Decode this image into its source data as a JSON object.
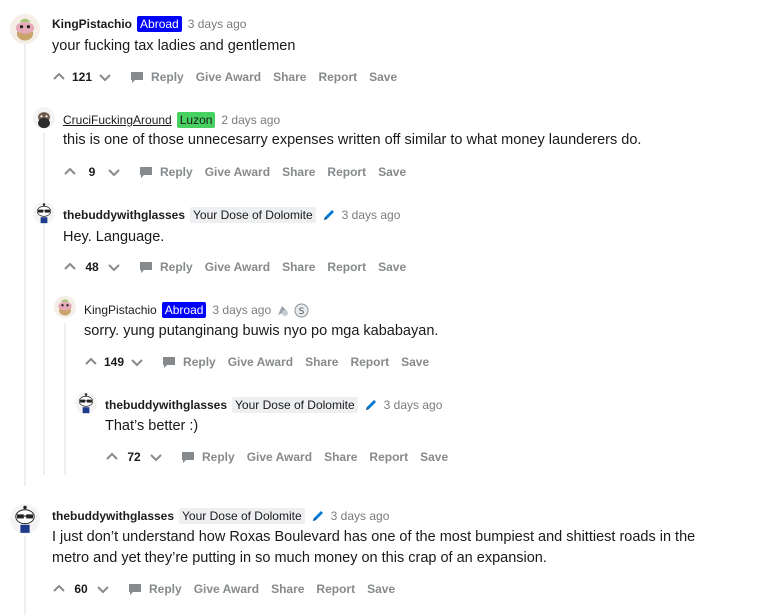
{
  "actions": {
    "reply": "Reply",
    "give_award": "Give Award",
    "share": "Share",
    "report": "Report",
    "save": "Save"
  },
  "comments": [
    {
      "author": "KingPistachio",
      "flair": "Abroad",
      "time": "3 days ago",
      "body": "your fucking tax ladies and gentlemen",
      "score": "121",
      "avatar": "pistachio-snoo-avatar"
    },
    {
      "author": "CruciFuckingAround",
      "flair": "Luzon",
      "time": "2 days ago",
      "body": "this is one of those unnecesarry expenses written off similar to what money launderers do.",
      "score": "9",
      "avatar": "bearded-snoo-avatar"
    },
    {
      "author": "thebuddywithglasses",
      "flair": "Your Dose of Dolomite",
      "time": "3 days ago",
      "body": "Hey. Language.",
      "score": "48",
      "avatar": "glasses-snoo-avatar"
    },
    {
      "author": "KingPistachio",
      "flair": "Abroad",
      "time": "3 days ago",
      "body": "sorry. yung putanginang buwis nyo po mga kababayan.",
      "score": "149",
      "avatar": "pistachio-snoo-avatar",
      "awards": [
        "rocket-like-award-icon",
        "silver-award-icon"
      ]
    },
    {
      "author": "thebuddywithglasses",
      "flair": "Your Dose of Dolomite",
      "time": "3 days ago",
      "body": "That’s better :)",
      "score": "72",
      "avatar": "glasses-snoo-avatar"
    },
    {
      "author": "thebuddywithglasses",
      "flair": "Your Dose of Dolomite",
      "time": "3 days ago",
      "body_lines": [
        "I just don’t understand how Roxas Boulevard has one of the most bumpiest and shittiest roads in the",
        "metro and yet they’re putting in so much money on this crap of an expansion."
      ],
      "score": "60",
      "avatar": "glasses-snoo-avatar"
    }
  ],
  "colors": {
    "flair_abroad": "#0000ff",
    "flair_luzon": "#46d160",
    "flair_dolomite": "#edeff1",
    "action_gray": "#878a8c",
    "pencil_blue": "#0079d3"
  }
}
